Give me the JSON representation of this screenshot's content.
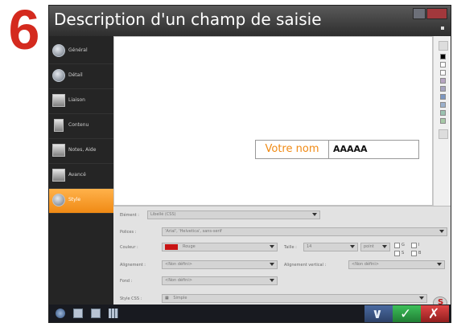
{
  "step_number": "6",
  "window": {
    "title": "Description d'un champ de saisie"
  },
  "sidebar": {
    "items": [
      {
        "label": "Général",
        "icon": "general-icon"
      },
      {
        "label": "Détail",
        "icon": "detail-icon"
      },
      {
        "label": "Liaison",
        "icon": "link-icon"
      },
      {
        "label": "Contenu",
        "icon": "content-icon"
      },
      {
        "label": "Notes, Aide",
        "icon": "notes-help-icon"
      },
      {
        "label": "Avancé",
        "icon": "advanced-icon"
      },
      {
        "label": "Style",
        "icon": "style-icon"
      }
    ],
    "active_index": 6,
    "accent_color": "#f08a14"
  },
  "preview": {
    "label": "Votre nom",
    "value": "AAAAA",
    "label_color": "#f08a14"
  },
  "side_swatches": [
    "#000000",
    "#ffffff",
    "#ffffff",
    "#b7a5c2",
    "#a7a4c0",
    "#7c97c1",
    "#9bb0cc",
    "#9bc2b0",
    "#a7c9a7"
  ],
  "properties": {
    "element_label": "Elément :",
    "element_value": "Libellé (CSS)",
    "font_label": "Polices :",
    "font_value": "'Arial', 'Helvetica', sans-serif",
    "color_label": "Couleur :",
    "color_value": "Rouge",
    "color_swatch": "#c81414",
    "size_label": "Taille :",
    "size_value": "14",
    "size_unit": "point",
    "checkbox_labels": [
      "G",
      "I",
      "S",
      "B"
    ],
    "align_label": "Alignement :",
    "align_value": "<Non défini>",
    "valign_label": "Alignement vertical :",
    "valign_value": "<Non défini>",
    "bg_label": "Fond :",
    "bg_value": "<Non défini>",
    "css_label": "Style CSS :",
    "css_value": "Simple"
  },
  "taskbar": {
    "icons": [
      "start-icon",
      "window-icon",
      "window-icon",
      "grid-icon"
    ],
    "cancel_color": "#c82828",
    "ok_color": "#2ca83c",
    "validate_color": "#2b6fb7"
  }
}
